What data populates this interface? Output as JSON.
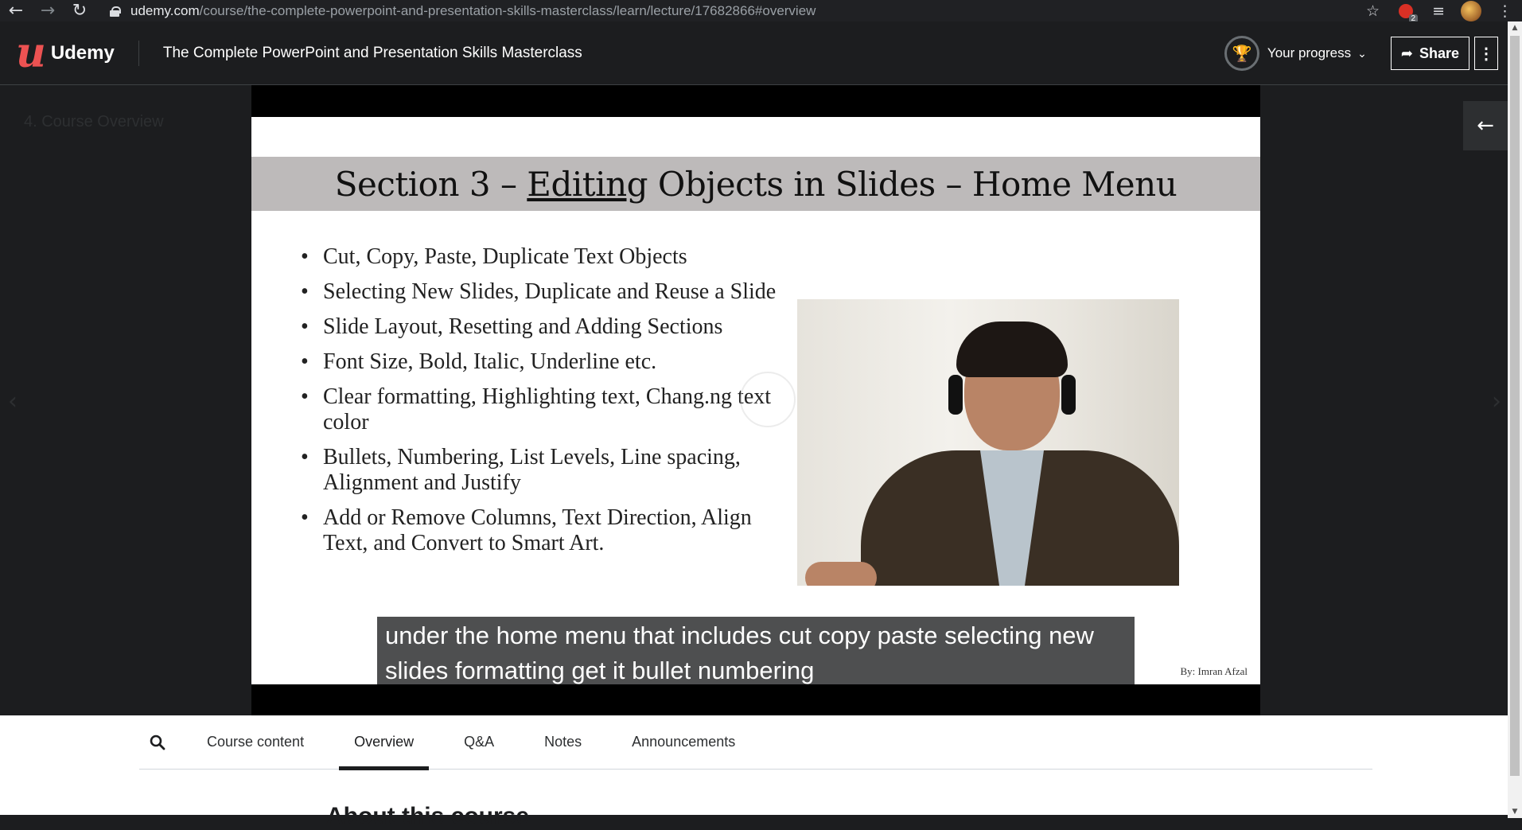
{
  "browser": {
    "url_host": "udemy.com",
    "url_path": "/course/the-complete-powerpoint-and-presentation-skills-masterclass/learn/lecture/17682866#overview",
    "extension_badge": "2"
  },
  "header": {
    "logo_text": "Udemy",
    "course_title": "The Complete PowerPoint and Presentation Skills Masterclass",
    "progress_label": "Your progress",
    "share_label": "Share"
  },
  "sidebar": {
    "section_label": "4. Course Overview"
  },
  "slide": {
    "heading_prefix": "Section 3 – ",
    "heading_underlined": "Editing",
    "heading_suffix": " Objects in Slides – Home Menu",
    "bullets": [
      "Cut, Copy, Paste, Duplicate Text Objects",
      "Selecting New Slides, Duplicate and Reuse a Slide",
      "Slide Layout, Resetting and Adding Sections",
      "Font Size, Bold, Italic, Underline etc.",
      "Clear formatting, Highlighting text, Chang.ng text color",
      "Bullets, Numbering, List Levels, Line spacing, Alignment and Justify",
      "Add or Remove Columns, Text Direction, Align Text, and Convert to Smart Art."
    ],
    "byline": "By: Imran Afzal"
  },
  "caption": {
    "text": "under the home menu that includes cut copy paste selecting new slides formatting get it bullet numbering"
  },
  "tabs": [
    {
      "label": "Course content"
    },
    {
      "label": "Overview"
    },
    {
      "label": "Q&A"
    },
    {
      "label": "Notes"
    },
    {
      "label": "Announcements"
    }
  ],
  "active_tab": "Overview",
  "overview": {
    "heading": "About this course"
  },
  "colors": {
    "brand": "#ec5252",
    "header_bg": "#1c1d1f",
    "slide_band": "#bdbaba"
  }
}
